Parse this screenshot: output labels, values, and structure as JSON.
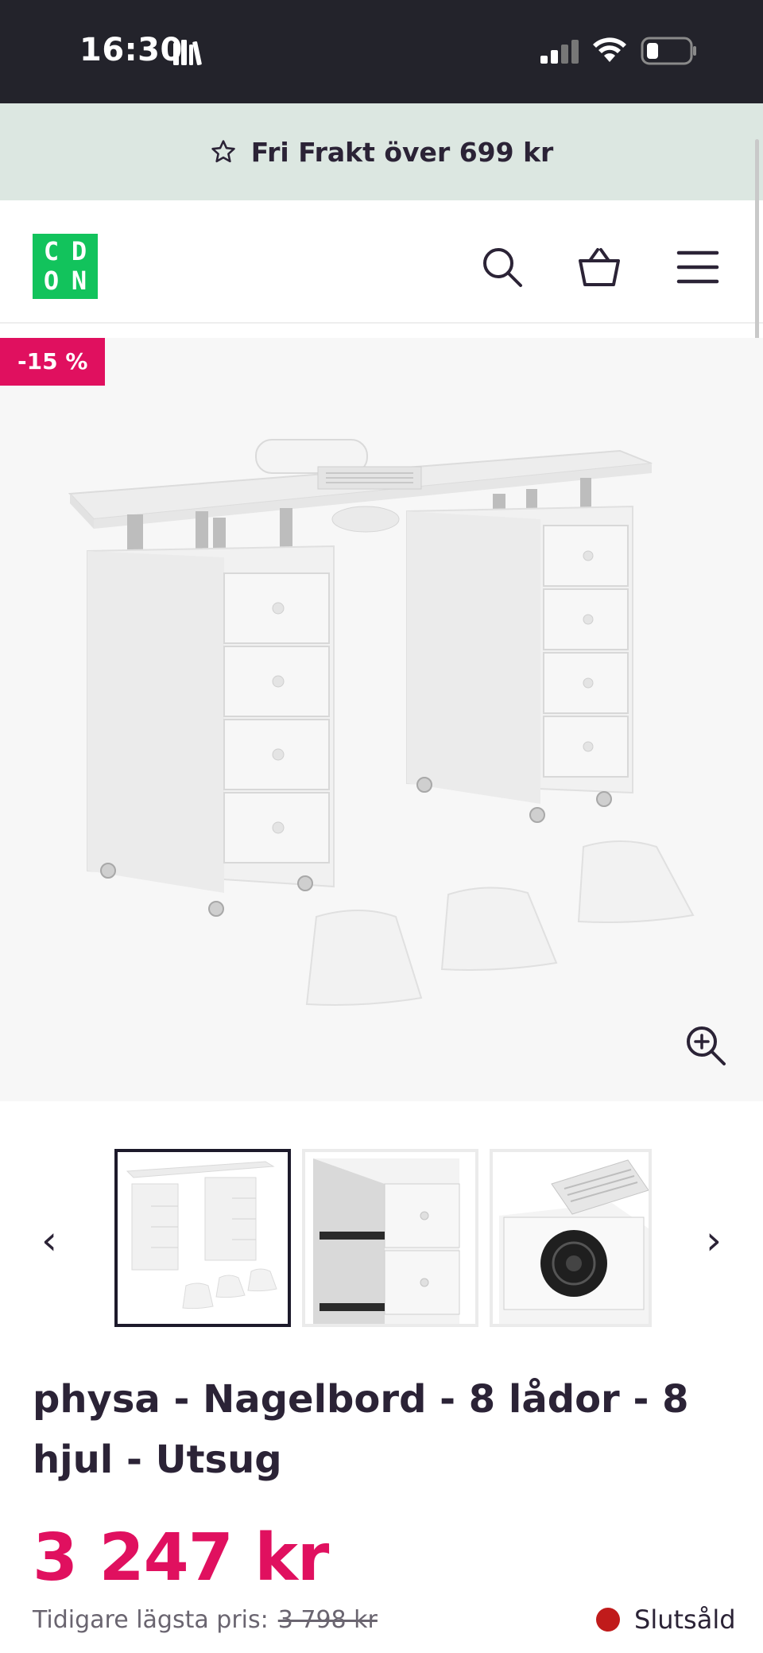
{
  "status_bar": {
    "time": "16:30"
  },
  "promo": {
    "text": "Fri Frakt över 699 kr",
    "icon": "star-outline-icon"
  },
  "header": {
    "logo_letters": [
      "C",
      "D",
      "O",
      "N"
    ],
    "logo_color": "#12c35c",
    "icons": [
      "search-icon",
      "basket-icon",
      "menu-icon"
    ]
  },
  "product": {
    "discount_badge": "-15 %",
    "title": "physa - Nagelbord - 8 lådor - 8 hjul - Utsug",
    "price": "3 247 kr",
    "previous_price_label": "Tidigare lägsta pris:",
    "previous_price": "3 798 kr",
    "stock_status": "Slutsåld",
    "accent_color": "#e0105f"
  },
  "gallery": {
    "thumbnails": [
      "thumbnail-table",
      "thumbnail-drawers",
      "thumbnail-fan"
    ],
    "active_index": 0
  }
}
